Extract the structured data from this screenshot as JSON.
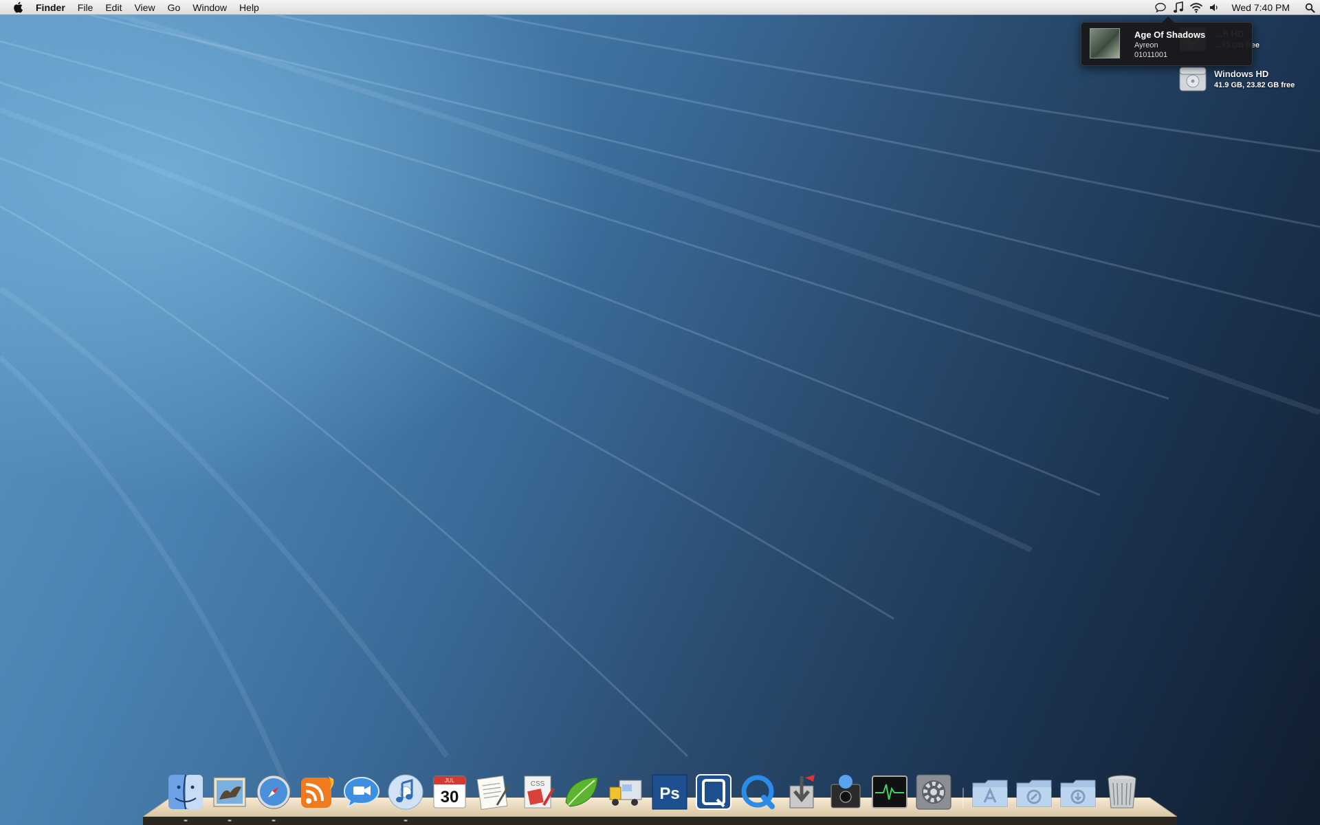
{
  "menubar": {
    "app_name": "Finder",
    "menus": [
      "File",
      "Edit",
      "View",
      "Go",
      "Window",
      "Help"
    ],
    "clock": "Wed 7:40 PM",
    "status_icons": [
      "chat-icon",
      "music-note-icon",
      "wifi-icon",
      "volume-icon"
    ]
  },
  "now_playing": {
    "track": "Age Of Shadows",
    "artist": "Ayreon",
    "album": "01011001"
  },
  "drives": [
    {
      "name": "…h HD",
      "info": "…73 GB free"
    },
    {
      "name": "Windows HD",
      "info": "41.9 GB, 23.82 GB free"
    }
  ],
  "dock": {
    "apps": [
      "finder",
      "mail",
      "safari",
      "rss",
      "ichat",
      "itunes",
      "ical",
      "textedit",
      "css-edit",
      "coda",
      "transmit",
      "photoshop",
      "quicksilver",
      "quicktime",
      "installer",
      "acquisition",
      "activity-monitor",
      "system-preferences"
    ],
    "stacks": [
      "applications-folder",
      "documents-folder",
      "downloads-folder",
      "trash"
    ]
  },
  "colors": {
    "menubar": "#e8e8e8",
    "desktop_light": "#6fa6d2",
    "desktop_dark": "#101d2e",
    "popup_bg": "#18181a"
  }
}
